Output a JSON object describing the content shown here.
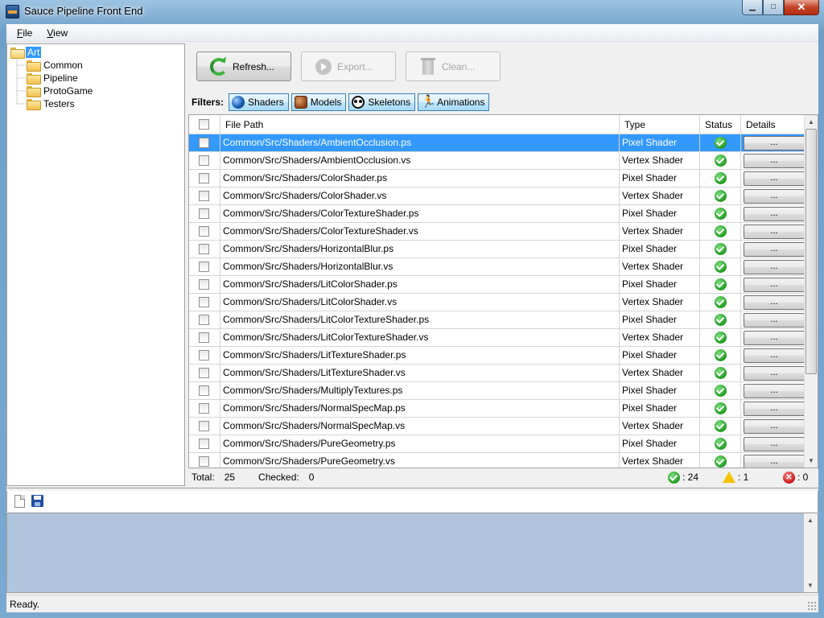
{
  "window": {
    "title": "Sauce Pipeline Front End",
    "minimize": "▁",
    "maximize": "□",
    "close": "✕"
  },
  "menu": [
    {
      "accel": "F",
      "rest": "ile"
    },
    {
      "accel": "V",
      "rest": "iew"
    }
  ],
  "tree": {
    "root": "Art",
    "children": [
      "Common",
      "Pipeline",
      "ProtoGame",
      "Testers"
    ]
  },
  "toolbar": {
    "refresh": "Refresh...",
    "export": "Export...",
    "clean": "Clean..."
  },
  "filters": {
    "label": "Filters:",
    "items": [
      {
        "label": "Shaders",
        "icon": "shader-sphere-icon"
      },
      {
        "label": "Models",
        "icon": "model-cube-icon"
      },
      {
        "label": "Skeletons",
        "icon": "skull-icon"
      },
      {
        "label": "Animations",
        "icon": "running-man-icon"
      }
    ]
  },
  "grid": {
    "headers": {
      "file_path": "File Path",
      "type": "Type",
      "status": "Status",
      "details": "Details"
    },
    "details_label": "...",
    "rows": [
      {
        "path": "Common/Src/Shaders/AmbientOcclusion.ps",
        "type": "Pixel Shader",
        "status": "ok",
        "selected": true
      },
      {
        "path": "Common/Src/Shaders/AmbientOcclusion.vs",
        "type": "Vertex Shader",
        "status": "ok"
      },
      {
        "path": "Common/Src/Shaders/ColorShader.ps",
        "type": "Pixel Shader",
        "status": "ok"
      },
      {
        "path": "Common/Src/Shaders/ColorShader.vs",
        "type": "Vertex Shader",
        "status": "ok"
      },
      {
        "path": "Common/Src/Shaders/ColorTextureShader.ps",
        "type": "Pixel Shader",
        "status": "ok"
      },
      {
        "path": "Common/Src/Shaders/ColorTextureShader.vs",
        "type": "Vertex Shader",
        "status": "ok"
      },
      {
        "path": "Common/Src/Shaders/HorizontalBlur.ps",
        "type": "Pixel Shader",
        "status": "ok"
      },
      {
        "path": "Common/Src/Shaders/HorizontalBlur.vs",
        "type": "Vertex Shader",
        "status": "ok"
      },
      {
        "path": "Common/Src/Shaders/LitColorShader.ps",
        "type": "Pixel Shader",
        "status": "ok"
      },
      {
        "path": "Common/Src/Shaders/LitColorShader.vs",
        "type": "Vertex Shader",
        "status": "ok"
      },
      {
        "path": "Common/Src/Shaders/LitColorTextureShader.ps",
        "type": "Pixel Shader",
        "status": "ok"
      },
      {
        "path": "Common/Src/Shaders/LitColorTextureShader.vs",
        "type": "Vertex Shader",
        "status": "ok"
      },
      {
        "path": "Common/Src/Shaders/LitTextureShader.ps",
        "type": "Pixel Shader",
        "status": "ok"
      },
      {
        "path": "Common/Src/Shaders/LitTextureShader.vs",
        "type": "Vertex Shader",
        "status": "ok"
      },
      {
        "path": "Common/Src/Shaders/MultiplyTextures.ps",
        "type": "Pixel Shader",
        "status": "ok"
      },
      {
        "path": "Common/Src/Shaders/NormalSpecMap.ps",
        "type": "Pixel Shader",
        "status": "ok"
      },
      {
        "path": "Common/Src/Shaders/NormalSpecMap.vs",
        "type": "Vertex Shader",
        "status": "ok"
      },
      {
        "path": "Common/Src/Shaders/PureGeometry.ps",
        "type": "Pixel Shader",
        "status": "ok"
      },
      {
        "path": "Common/Src/Shaders/PureGeometry.vs",
        "type": "Vertex Shader",
        "status": "ok"
      }
    ]
  },
  "summary": {
    "total_label": "Total:",
    "total": "25",
    "checked_label": "Checked:",
    "checked": "0",
    "ok_count": ": 24",
    "warn_count": ": 1",
    "error_count": ": 0"
  },
  "status_bar": {
    "text": "Ready."
  },
  "colors": {
    "selection": "#3399ff",
    "log_background": "#b0c4de",
    "ok": "#1f9a1f",
    "warn": "#f5c400",
    "error": "#c81414"
  }
}
